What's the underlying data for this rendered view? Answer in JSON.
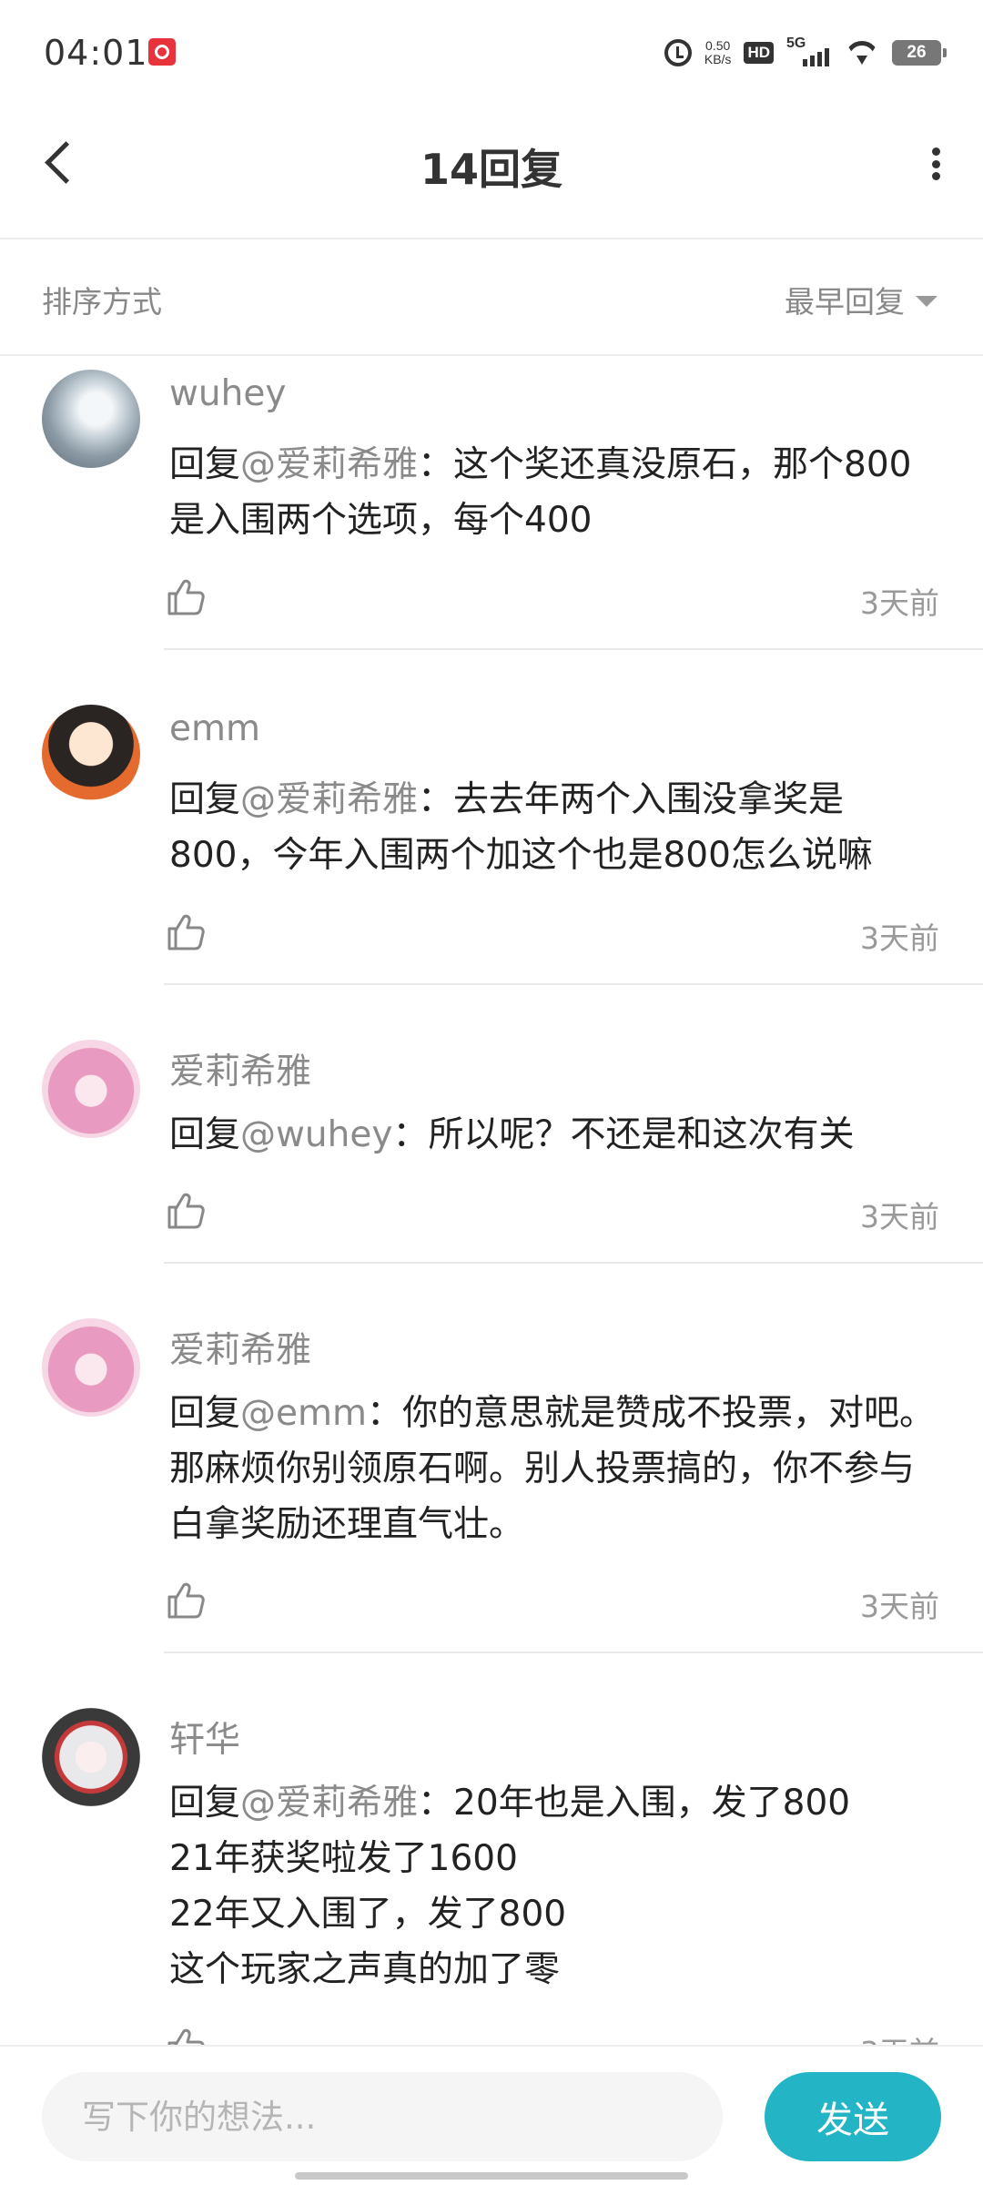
{
  "status_bar": {
    "time": "04:01",
    "net_speed_value": "0.50",
    "net_speed_unit": "KB/s",
    "hd_label": "HD",
    "network_label": "5G",
    "battery": "26"
  },
  "header": {
    "title": "14回复"
  },
  "sort": {
    "label": "排序方式",
    "selected": "最早回复"
  },
  "replies": [
    {
      "username": "wuhey",
      "reply_prefix": "回复",
      "mention": "@爱莉希雅",
      "text": "：这个奖还真没原石，那个800是入围两个选项，每个400",
      "time": "3天前"
    },
    {
      "username": "emm",
      "reply_prefix": "回复",
      "mention": "@爱莉希雅",
      "text": "：去去年两个入围没拿奖是800，今年入围两个加这个也是800怎么说嘛",
      "time": "3天前"
    },
    {
      "username": "爱莉希雅",
      "reply_prefix": "回复",
      "mention": "@wuhey",
      "text": "：所以呢？不还是和这次有关",
      "time": "3天前"
    },
    {
      "username": "爱莉希雅",
      "reply_prefix": "回复",
      "mention": "@emm",
      "text": "：你的意思就是赞成不投票，对吧。那麻烦你别领原石啊。别人投票搞的，你不参与白拿奖励还理直气壮。",
      "time": "3天前"
    },
    {
      "username": "轩华",
      "reply_prefix": "回复",
      "mention": "@爱莉希雅",
      "text": "：20年也是入围，发了800\n21年获奖啦发了1600\n22年又入围了，发了800\n这个玩家之声真的加了零",
      "time": "3天前"
    }
  ],
  "composer": {
    "placeholder": "写下你的想法...",
    "send_label": "发送"
  }
}
